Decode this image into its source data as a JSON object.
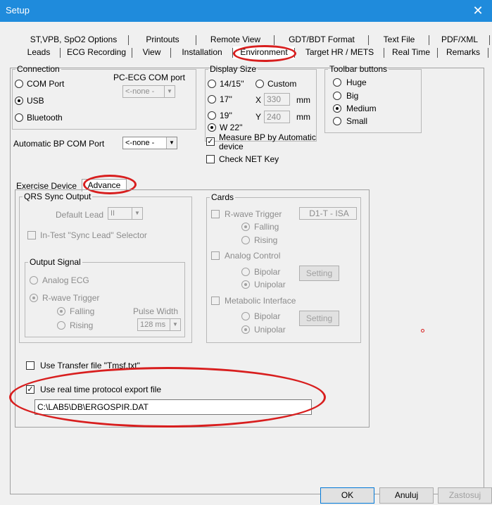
{
  "window": {
    "title": "Setup",
    "close_glyph": "✕"
  },
  "tabs_row1": [
    "ST,VPB, SpO2 Options",
    "Printouts",
    "Remote View",
    "GDT/BDT Format",
    "Text File",
    "PDF/XML"
  ],
  "tabs_row2": [
    "Leads",
    "ECG Recording",
    "View",
    "Installation",
    "Environment",
    "Target HR / METS",
    "Real Time",
    "Remarks"
  ],
  "connection": {
    "title": "Connection",
    "com_port_label": "PC-ECG COM port",
    "options": [
      "COM Port",
      "USB",
      "Bluetooth"
    ],
    "selected": "USB",
    "com_value": "<-none -"
  },
  "display_size": {
    "title": "Display Size",
    "options": [
      "14/15''",
      "17''",
      "19''",
      "W 22''"
    ],
    "selected": "W 22''",
    "custom_label": "Custom",
    "x_label": "X",
    "x_value": "330",
    "y_label": "Y",
    "y_value": "240",
    "unit": "mm"
  },
  "toolbar_buttons": {
    "title": "Toolbar buttons",
    "options": [
      "Huge",
      "Big",
      "Medium",
      "Small"
    ],
    "selected": "Medium"
  },
  "auto_bp": {
    "label": "Automatic BP COM Port",
    "value": "<-none -"
  },
  "measure_bp": {
    "label_line1": "Measure BP by Automatic",
    "label_line2": "device",
    "checked": true
  },
  "check_net_key": {
    "label": "Check NET Key",
    "checked": false
  },
  "inner_tabs": [
    "Exercise Device",
    "Advance"
  ],
  "qrs_sync": {
    "title": "QRS Sync Output",
    "default_lead_label": "Default Lead",
    "default_lead_value": "II",
    "in_test_label": "In-Test \"Sync Lead\" Selector"
  },
  "output_signal": {
    "title": "Output Signal",
    "analog_ecg": "Analog ECG",
    "rwave_trigger": "R-wave Trigger",
    "falling": "Falling",
    "rising": "Rising",
    "pulse_width_label": "Pulse Width",
    "pulse_width_value": "128 ms"
  },
  "cards": {
    "title": "Cards",
    "rwave_trigger": "R-wave Trigger",
    "rwave_value": "D1-T - ISA",
    "falling": "Falling",
    "rising": "Rising",
    "analog_control": "Analog Control",
    "bipolar": "Bipolar",
    "unipolar": "Unipolar",
    "setting": "Setting",
    "metabolic_interface": "Metabolic Interface"
  },
  "transfer_file": {
    "label": "Use Transfer file \"Tmsf.txt\"",
    "checked": false
  },
  "realtime_export": {
    "label": "Use real time protocol export file",
    "checked": true,
    "path": "C:\\LAB5\\DB\\ERGOSPIR.DAT"
  },
  "buttons": {
    "ok": "OK",
    "cancel": "Anuluj",
    "apply": "Zastosuj"
  },
  "colors": {
    "titlebar": "#1f8bdc",
    "annotation": "#d81e1e"
  }
}
